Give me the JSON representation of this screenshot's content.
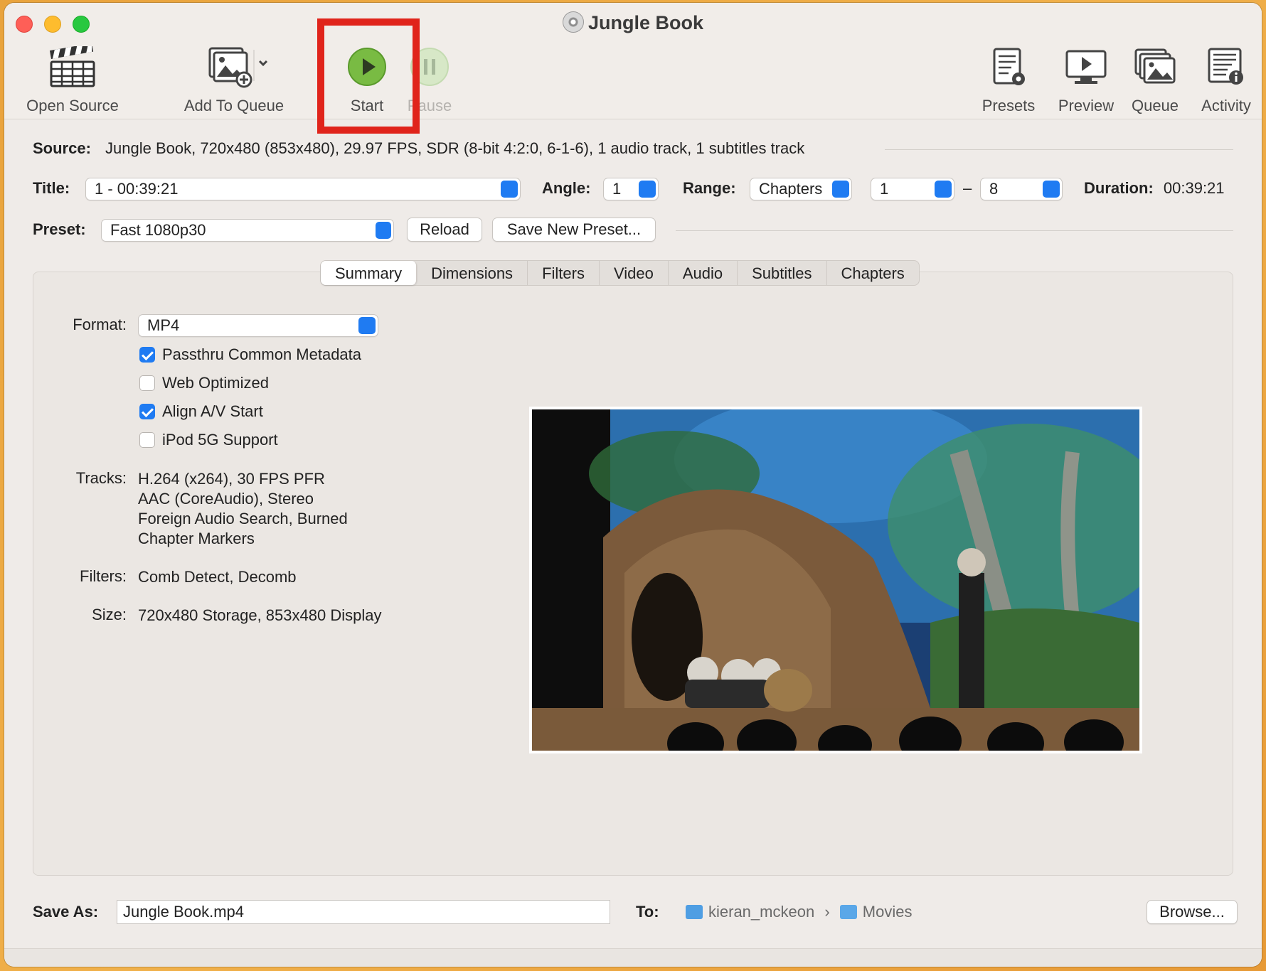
{
  "window": {
    "title": "Jungle Book"
  },
  "toolbar": {
    "open_source": "Open Source",
    "add_to_queue": "Add To Queue",
    "start": "Start",
    "pause": "Pause",
    "presets": "Presets",
    "preview": "Preview",
    "queue": "Queue",
    "activity": "Activity"
  },
  "source": {
    "label": "Source:",
    "value": "Jungle Book, 720x480 (853x480), 29.97 FPS, SDR (8-bit 4:2:0, 6-1-6), 1 audio track, 1 subtitles track"
  },
  "title_row": {
    "title_label": "Title:",
    "title_value": "1 - 00:39:21",
    "angle_label": "Angle:",
    "angle_value": "1",
    "range_label": "Range:",
    "range_value": "Chapters",
    "range_start": "1",
    "range_dash": "–",
    "range_end": "8",
    "duration_label": "Duration:",
    "duration_value": "00:39:21"
  },
  "preset_row": {
    "label": "Preset:",
    "value": "Fast 1080p30",
    "reload": "Reload",
    "save_new": "Save New Preset..."
  },
  "tabs": [
    "Summary",
    "Dimensions",
    "Filters",
    "Video",
    "Audio",
    "Subtitles",
    "Chapters"
  ],
  "summary": {
    "format_label": "Format:",
    "format_value": "MP4",
    "options": [
      {
        "label": "Passthru Common Metadata",
        "checked": true
      },
      {
        "label": "Web Optimized",
        "checked": false
      },
      {
        "label": "Align A/V Start",
        "checked": true
      },
      {
        "label": "iPod 5G Support",
        "checked": false
      }
    ],
    "tracks_label": "Tracks:",
    "tracks": [
      "H.264 (x264), 30 FPS PFR",
      "AAC (CoreAudio), Stereo",
      "Foreign Audio Search, Burned",
      "Chapter Markers"
    ],
    "filters_label": "Filters:",
    "filters_value": "Comb Detect, Decomb",
    "size_label": "Size:",
    "size_value": "720x480 Storage, 853x480 Display"
  },
  "save": {
    "label": "Save As:",
    "filename": "Jungle Book.mp4",
    "to_label": "To:",
    "path": [
      "kieran_mckeon",
      "Movies"
    ],
    "browse": "Browse..."
  }
}
